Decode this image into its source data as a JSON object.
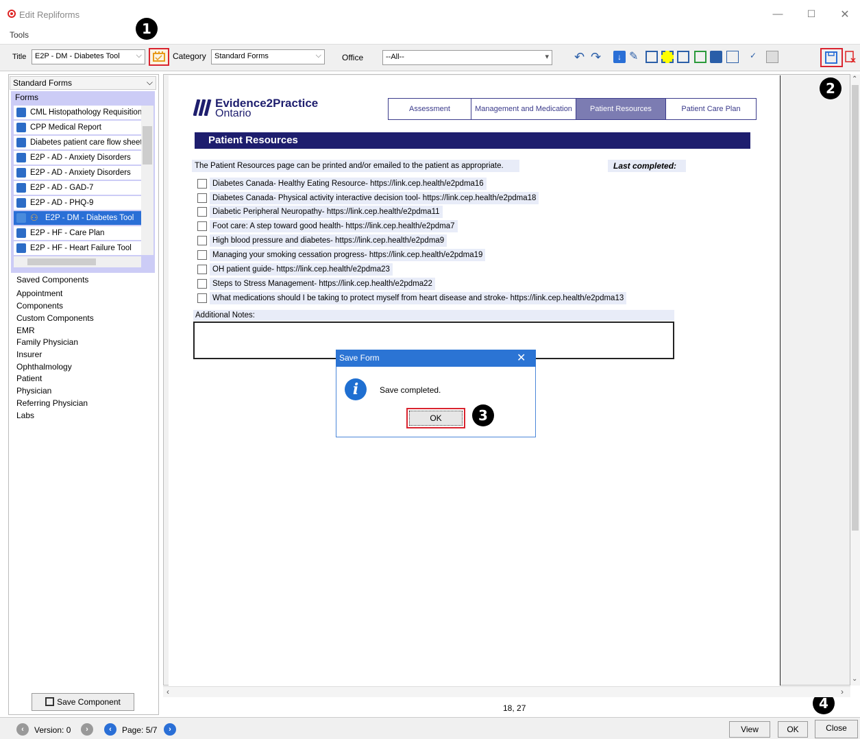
{
  "window": {
    "title": "Edit Repliforms",
    "menu": "Tools",
    "controls": {
      "minimize": "—",
      "maximize": "☐",
      "close": "✕"
    }
  },
  "toolbar": {
    "title_label": "Title",
    "title_value": "E2P - DM - Diabetes Tool",
    "category_label": "Category",
    "category_value": "Standard Forms",
    "office_label": "Office",
    "office_value": "--All--"
  },
  "left": {
    "category_select": "Standard Forms",
    "forms_header": "Forms",
    "forms": [
      "CML Histopathology Requisition",
      "CPP Medical Report",
      "Diabetes patient care flow sheet",
      "E2P - AD - Anxiety Disorders",
      "E2P - AD - Anxiety Disorders",
      "E2P - AD - GAD-7",
      "E2P - AD - PHQ-9",
      "E2P - DM - Diabetes Tool",
      "E2P - HF - Care Plan",
      "E2P - HF - Heart Failure Tool"
    ],
    "components_header": "Saved Components",
    "components": [
      "Appointment",
      "Components",
      "Custom Components",
      "EMR",
      "Family Physician",
      "Insurer",
      "Ophthalmology",
      "Patient",
      "Physician",
      "Referring Physician",
      "Labs"
    ],
    "save_component": "Save Component"
  },
  "form": {
    "logo_main": "Evidence2Practice",
    "logo_sub": "Ontario",
    "tabs": [
      "Assessment",
      "Management and Medication",
      "Patient Resources",
      "Patient Care Plan"
    ],
    "section_title": "Patient Resources",
    "intro": "The Patient Resources page can be printed and/or emailed to the patient as appropriate.",
    "last_completed": "Last completed:",
    "resources": [
      "Diabetes Canada- Healthy Eating Resource- https://link.cep.health/e2pdma16",
      "Diabetes Canada- Physical activity interactive decision tool- https://link.cep.health/e2pdma18",
      "Diabetic Peripheral Neuropathy- https://link.cep.health/e2pdma11",
      "Foot care: A step toward good health- https://link.cep.health/e2pdma7",
      "High blood pressure and diabetes- https://link.cep.health/e2pdma9",
      "Managing your smoking cessation progress- https://link.cep.health/e2pdma19",
      "OH patient guide- https://link.cep.health/e2pdma23",
      "Steps to Stress Management- https://link.cep.health/e2pdma22",
      "What medications should I be taking to protect myself from heart disease and stroke- https://link.cep.health/e2pdma13"
    ],
    "notes_label": "Additional Notes:"
  },
  "dialog": {
    "title": "Save Form",
    "message": "Save completed.",
    "ok": "OK"
  },
  "callouts": [
    "1",
    "2",
    "3",
    "4"
  ],
  "status": {
    "coords": "18, 27",
    "version": "Version: 0",
    "page": "Page: 5/7",
    "view": "View",
    "ok": "OK",
    "close": "Close"
  },
  "colors": {
    "accent": "#2a6fd6",
    "navy": "#1e1e6e",
    "highlight": "#d9232e"
  }
}
